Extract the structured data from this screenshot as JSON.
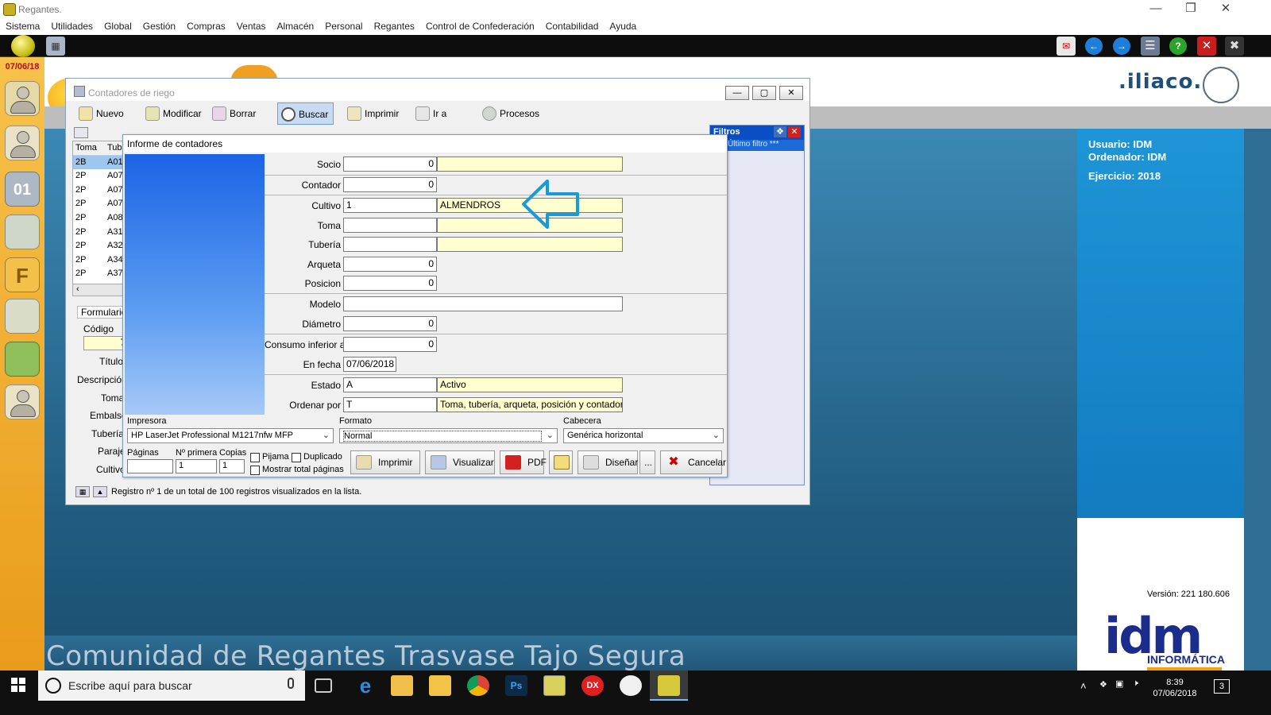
{
  "app": {
    "title": "Regantes.",
    "date": "07/06/18"
  },
  "menu": [
    "Sistema",
    "Utilidades",
    "Global",
    "Gestión",
    "Compras",
    "Ventas",
    "Almacén",
    "Personal",
    "Regantes",
    "Control de Confederación",
    "Contabilidad",
    "Ayuda"
  ],
  "brand": {
    "watermark": "Comunidad de Regantes Trasvase Tajo Segura",
    "logo_text": ".iliaco.",
    "user_label": "Usuario: IDM",
    "computer_label": "Ordenador: IDM",
    "year_label": "Ejercicio: 2018",
    "version": "Versión: 221 180.606",
    "idm_logo": "idm",
    "idm_sub": "INFORMÁTICA"
  },
  "main_window": {
    "title": "Contadores de riego",
    "toolbar": [
      "Nuevo",
      "Modificar",
      "Borrar",
      "Buscar",
      "Imprimir",
      "Ir a",
      "Procesos"
    ],
    "table": {
      "headers": [
        "Toma",
        "Tube"
      ],
      "rows": [
        [
          "2B",
          "A01"
        ],
        [
          "2P",
          "A07"
        ],
        [
          "2P",
          "A07"
        ],
        [
          "2P",
          "A07"
        ],
        [
          "2P",
          "A08"
        ],
        [
          "2P",
          "A31"
        ],
        [
          "2P",
          "A32"
        ],
        [
          "2P",
          "A34"
        ],
        [
          "2P",
          "A37"
        ]
      ]
    },
    "form_tab": "Formulario",
    "form_fields": [
      "Código",
      "Título",
      "Descripción",
      "Toma",
      "Embalse",
      "Tubería",
      "Paraje",
      "Cultivo"
    ],
    "codigo_value": "7",
    "filters": {
      "title": "Filtros",
      "last": "Último filtro ***"
    },
    "status": "Registro nº 1 de un total de 100 registros visualizados en la lista."
  },
  "dialog": {
    "title": "Informe de contadores",
    "fields": {
      "socio": {
        "label": "Socio",
        "value": "0"
      },
      "contador": {
        "label": "Contador",
        "value": "0"
      },
      "cultivo": {
        "label": "Cultivo",
        "value": "1",
        "desc": "ALMENDROS"
      },
      "toma": {
        "label": "Toma",
        "value": ""
      },
      "tuberia": {
        "label": "Tubería",
        "value": ""
      },
      "arqueta": {
        "label": "Arqueta",
        "value": "0"
      },
      "posicion": {
        "label": "Posicion",
        "value": "0"
      },
      "modelo": {
        "label": "Modelo",
        "value": ""
      },
      "diametro": {
        "label": "Diámetro",
        "value": "0"
      },
      "consumo": {
        "label": "Consumo inferior a",
        "value": "0"
      },
      "en_fecha": {
        "label": "En fecha",
        "value": "07/06/2018"
      },
      "estado": {
        "label": "Estado",
        "value": "A",
        "desc": "Activo"
      },
      "ordenar": {
        "label": "Ordenar por",
        "value": "T",
        "desc": "Toma, tubería, arqueta, posición y contador"
      }
    },
    "impresora": {
      "label": "Impresora",
      "value": "HP LaserJet Professional M1217nfw MFP"
    },
    "formato": {
      "label": "Formato",
      "value": "Normal"
    },
    "cabecera": {
      "label": "Cabecera",
      "value": "Genérica horizontal"
    },
    "paginas_label": "Páginas",
    "primera_label": "Nº primera",
    "primera_value": "1",
    "copias_label": "Copias",
    "copias_value": "1",
    "pijama": "Pijama",
    "duplicado": "Duplicado",
    "mostrar": "Mostrar total páginas",
    "buttons": {
      "imprimir": "Imprimir",
      "visualizar": "Visualizar",
      "pdf": "PDF",
      "disenar": "Diseñar",
      "more": "...",
      "cancelar": "Cancelar"
    }
  },
  "taskbar": {
    "search_placeholder": "Escribe aquí para buscar",
    "time": "8:39",
    "date": "07/06/2018",
    "notifications": "3"
  },
  "colors": {
    "accent": "#1e95d6",
    "arrow": "#1a9ad9",
    "highlight": "#ffffd0"
  }
}
